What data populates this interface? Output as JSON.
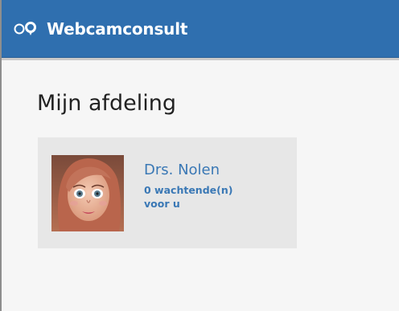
{
  "header": {
    "brand": "Webcamconsult",
    "logo_icon": "webcam-logo-icon",
    "background_color": "#2f6faf"
  },
  "page": {
    "title": "Mijn afdeling"
  },
  "department": {
    "doctors": [
      {
        "name": "Drs. Nolen",
        "queue_line_1": "0 wachtende(n)",
        "queue_line_2": "voor u",
        "avatar_icon": "doctor-avatar",
        "accent_color": "#3a78b5"
      }
    ]
  }
}
